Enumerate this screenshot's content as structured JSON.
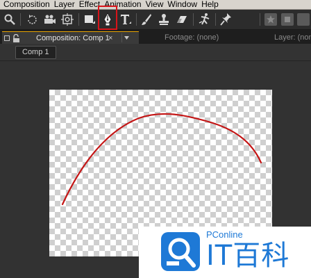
{
  "menu": [
    "Composition",
    "Layer",
    "Effect",
    "Animation",
    "View",
    "Window",
    "Help"
  ],
  "toolbar": {
    "tools": [
      "zoom-icon",
      "rotate-icon",
      "camera-icon",
      "pan-behind-icon",
      "rectangle-icon",
      "pen-icon",
      "type-icon",
      "brush-icon",
      "clone-stamp-icon",
      "eraser-icon",
      "puppet-icon",
      "pin-icon"
    ],
    "selected_tool": "pen-icon",
    "highlight_color": "#d8141a"
  },
  "tabs": {
    "composition": "Composition: Comp 1",
    "footage": "Footage: (none)",
    "layer": "Layer: (none)"
  },
  "comp_chip": "Comp 1",
  "watermark": {
    "brand_small": "PConline",
    "brand_large": "IT百科",
    "color": "#1e79d6"
  },
  "stroke_color": "#c41414"
}
